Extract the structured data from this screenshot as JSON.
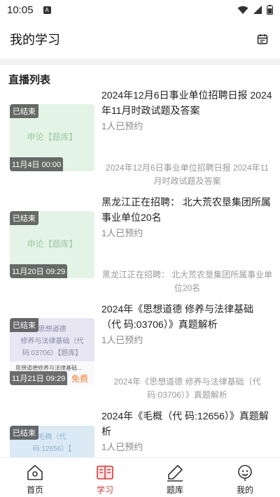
{
  "status_bar": {
    "time": "10:05",
    "notif_letter": "A"
  },
  "header": {
    "title": "我的学习"
  },
  "section": {
    "title": "直播列表"
  },
  "items": [
    {
      "title": "2024年12月6日事业单位招聘日报 2024年11月时政试题及答案",
      "count": "1人已预约",
      "desc": "2024年12月6日事业单位招聘日报 2024年11月时政试题及答案",
      "badge": "已结束",
      "time": "11月4日 00:00",
      "thumb_text": "申论【题库】"
    },
    {
      "title": "黑龙江正在招聘： 北大荒农垦集团所属事业单位20名",
      "count": "1人已预约",
      "desc": "黑龙江正在招聘： 北大荒农垦集团所属事业单位20名",
      "badge": "已结束",
      "time": "11月20日 09:29",
      "thumb_text": "申论【题库】"
    },
    {
      "title": "2024年《思想道德 修养与法律基础（代 码:03706）》真题解析",
      "count": "1人已预约",
      "desc": "2024年《思想道德 修养与法律基础（代码:03706）》真题解析",
      "badge": "已结束",
      "time": "11月21日 09:29",
      "free": "免费",
      "thumb_lines": [
        "思想道德",
        "修养与法律基础（代",
        "码:03706）【题库】"
      ],
      "thumb_strip": "思想道德修养与法律基础..."
    },
    {
      "title": "2024年《毛概（代 码:12656）》真题解析",
      "count": "1人已预约",
      "badge": "已结束",
      "thumb_lines": [
        "毛概（代",
        "码:12656）【"
      ]
    }
  ],
  "nav": [
    {
      "label": "首页",
      "icon": "home-icon"
    },
    {
      "label": "学习",
      "icon": "study-icon",
      "active": true
    },
    {
      "label": "题库",
      "icon": "pencil-icon"
    },
    {
      "label": "我的",
      "icon": "profile-icon"
    }
  ],
  "colors": {
    "accent": "#d13a3a",
    "free": "#f27d2d",
    "thumb_green": "#e3f3e6",
    "thumb_purple": "#e8e6f3",
    "thumb_blue": "#dbeaf5"
  }
}
